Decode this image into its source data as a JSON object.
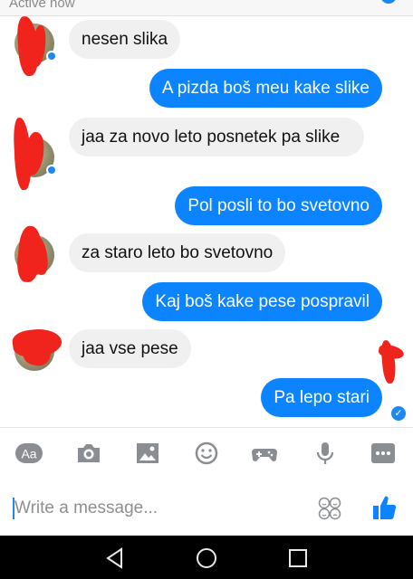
{
  "header": {
    "status": "Active now"
  },
  "messages": [
    {
      "side": "in",
      "text": "nesen slika"
    },
    {
      "side": "out",
      "text": "A pizda boš meu kake slike"
    },
    {
      "side": "in",
      "text": "jaa za novo leto posnetek pa slike"
    },
    {
      "side": "out",
      "text": "Pol posli to bo svetovno"
    },
    {
      "side": "in",
      "text": "za staro leto bo  svetovno"
    },
    {
      "side": "out",
      "text": "Kaj boš kake pese pospravil"
    },
    {
      "side": "in",
      "text": "jaa vse pese"
    },
    {
      "side": "out",
      "text": "Pa lepo stari"
    }
  ],
  "toolbar": {
    "text_style_label": "Aa",
    "icons": [
      "text-style-icon",
      "camera-icon",
      "gallery-icon",
      "emoji-icon",
      "game-controller-icon",
      "microphone-icon",
      "more-icon"
    ]
  },
  "composer": {
    "placeholder": "Write a message..."
  },
  "colors": {
    "accent": "#0d84ff",
    "incoming_bubble": "#f1f0f0",
    "toolbar_icon": "#8a8d91",
    "redaction": "#f0241c"
  }
}
